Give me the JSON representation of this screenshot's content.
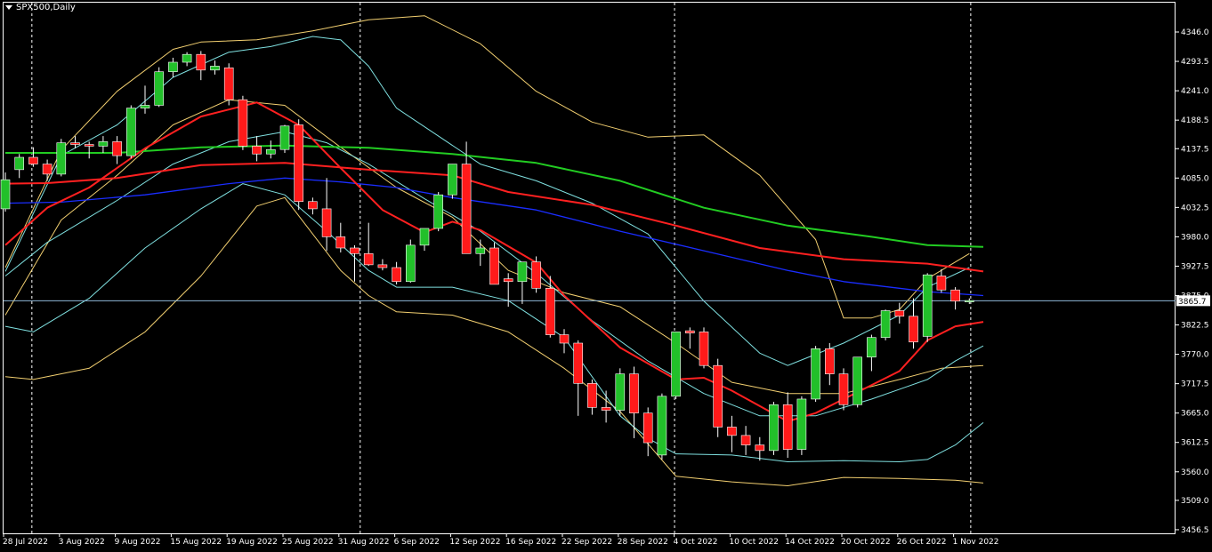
{
  "header": {
    "symbol_title": "SPX500,Daily"
  },
  "colors": {
    "bg": "#000000",
    "frame": "#ffffff",
    "up": "#22c02a",
    "down": "#ff1a1a",
    "ma_green": "#22cc22",
    "ma_red": "#ff2020",
    "ma_blue": "#1a2dff",
    "band_yellow": "#f2cf70",
    "band_cyan": "#7fe0e0",
    "bid_line": "#8fb8d8"
  },
  "chart_data": {
    "type": "candlestick",
    "ylim": [
      3430,
      4380
    ],
    "y_ticks": [
      "4346.0",
      "4293.5",
      "4241.0",
      "4188.5",
      "4137.5",
      "4085.0",
      "4032.5",
      "3980.0",
      "3927.5",
      "3875.0",
      "3822.5",
      "3770.0",
      "3717.5",
      "3665.0",
      "3612.5",
      "3560.0",
      "3509.0",
      "3456.5"
    ],
    "current_price": "3865.7",
    "x_labels": [
      {
        "i": 0,
        "label": "28 Jul 2022"
      },
      {
        "i": 4,
        "label": "3 Aug 2022"
      },
      {
        "i": 8,
        "label": "9 Aug 2022"
      },
      {
        "i": 12,
        "label": "15 Aug 2022"
      },
      {
        "i": 16,
        "label": "19 Aug 2022"
      },
      {
        "i": 20,
        "label": "25 Aug 2022"
      },
      {
        "i": 24,
        "label": "31 Aug 2022"
      },
      {
        "i": 28,
        "label": "6 Sep 2022"
      },
      {
        "i": 32,
        "label": "12 Sep 2022"
      },
      {
        "i": 36,
        "label": "16 Sep 2022"
      },
      {
        "i": 40,
        "label": "22 Sep 2022"
      },
      {
        "i": 44,
        "label": "28 Sep 2022"
      },
      {
        "i": 48,
        "label": "4 Oct 2022"
      },
      {
        "i": 52,
        "label": "10 Oct 2022"
      },
      {
        "i": 56,
        "label": "14 Oct 2022"
      },
      {
        "i": 60,
        "label": "20 Oct 2022"
      },
      {
        "i": 64,
        "label": "26 Oct 2022"
      },
      {
        "i": 68,
        "label": "1 Nov 2022"
      }
    ],
    "period_separators_at": [
      1.9,
      25.4,
      47.9,
      69.1
    ],
    "candles": [
      [
        4030,
        4095,
        4025,
        4082
      ],
      [
        4100,
        4128,
        4085,
        4122
      ],
      [
        4122,
        4140,
        4105,
        4110
      ],
      [
        4110,
        4118,
        4080,
        4092
      ],
      [
        4092,
        4155,
        4088,
        4148
      ],
      [
        4148,
        4160,
        4138,
        4145
      ],
      [
        4145,
        4150,
        4120,
        4142
      ],
      [
        4142,
        4160,
        4130,
        4150
      ],
      [
        4150,
        4160,
        4110,
        4125
      ],
      [
        4125,
        4215,
        4120,
        4210
      ],
      [
        4210,
        4250,
        4200,
        4215
      ],
      [
        4215,
        4283,
        4212,
        4275
      ],
      [
        4275,
        4300,
        4265,
        4292
      ],
      [
        4292,
        4310,
        4285,
        4306
      ],
      [
        4306,
        4312,
        4260,
        4278
      ],
      [
        4278,
        4295,
        4270,
        4285
      ],
      [
        4282,
        4290,
        4215,
        4225
      ],
      [
        4225,
        4232,
        4135,
        4142
      ],
      [
        4142,
        4160,
        4115,
        4128
      ],
      [
        4128,
        4152,
        4120,
        4136
      ],
      [
        4136,
        4180,
        4130,
        4178
      ],
      [
        4180,
        4190,
        4028,
        4043
      ],
      [
        4043,
        4050,
        4020,
        4030
      ],
      [
        4030,
        4085,
        3955,
        3980
      ],
      [
        3980,
        4005,
        3952,
        3960
      ],
      [
        3960,
        3965,
        3900,
        3950
      ],
      [
        3950,
        4005,
        3928,
        3930
      ],
      [
        3930,
        3940,
        3920,
        3925
      ],
      [
        3925,
        3935,
        3895,
        3900
      ],
      [
        3900,
        3975,
        3898,
        3965
      ],
      [
        3965,
        3990,
        3955,
        3995
      ],
      [
        3995,
        4060,
        3990,
        4055
      ],
      [
        4055,
        4110,
        4048,
        4110
      ],
      [
        4110,
        4150,
        3950,
        3950
      ],
      [
        3950,
        3975,
        3928,
        3960
      ],
      [
        3960,
        3970,
        3895,
        3895
      ],
      [
        3905,
        3915,
        3855,
        3900
      ],
      [
        3900,
        3920,
        3860,
        3935
      ],
      [
        3935,
        3945,
        3880,
        3888
      ],
      [
        3888,
        3910,
        3800,
        3805
      ],
      [
        3805,
        3815,
        3772,
        3790
      ],
      [
        3790,
        3795,
        3660,
        3718
      ],
      [
        3718,
        3725,
        3662,
        3675
      ],
      [
        3675,
        3705,
        3648,
        3670
      ],
      [
        3670,
        3745,
        3660,
        3735
      ],
      [
        3735,
        3748,
        3620,
        3665
      ],
      [
        3665,
        3675,
        3588,
        3612
      ],
      [
        3590,
        3700,
        3582,
        3695
      ],
      [
        3695,
        3810,
        3690,
        3810
      ],
      [
        3812,
        3818,
        3780,
        3808
      ],
      [
        3810,
        3818,
        3745,
        3750
      ],
      [
        3750,
        3762,
        3622,
        3640
      ],
      [
        3640,
        3660,
        3595,
        3625
      ],
      [
        3625,
        3642,
        3590,
        3608
      ],
      [
        3608,
        3622,
        3580,
        3598
      ],
      [
        3598,
        3685,
        3590,
        3680
      ],
      [
        3680,
        3702,
        3585,
        3600
      ],
      [
        3600,
        3695,
        3590,
        3690
      ],
      [
        3690,
        3785,
        3685,
        3780
      ],
      [
        3780,
        3790,
        3715,
        3735
      ],
      [
        3735,
        3745,
        3670,
        3680
      ],
      [
        3680,
        3765,
        3675,
        3765
      ],
      [
        3765,
        3805,
        3740,
        3800
      ],
      [
        3800,
        3850,
        3795,
        3848
      ],
      [
        3848,
        3862,
        3825,
        3838
      ],
      [
        3838,
        3870,
        3780,
        3792
      ],
      [
        3802,
        3915,
        3792,
        3912
      ],
      [
        3910,
        3922,
        3880,
        3885
      ],
      [
        3885,
        3890,
        3850,
        3865
      ],
      [
        3866,
        3870,
        3860,
        3866
      ]
    ],
    "ma_green": [
      [
        0,
        4130
      ],
      [
        3,
        4130
      ],
      [
        8,
        4130
      ],
      [
        14,
        4140
      ],
      [
        20,
        4143
      ],
      [
        26,
        4139
      ],
      [
        32,
        4128
      ],
      [
        38,
        4112
      ],
      [
        44,
        4080
      ],
      [
        50,
        4032
      ],
      [
        56,
        4000
      ],
      [
        62,
        3980
      ],
      [
        66,
        3965
      ],
      [
        70,
        3962
      ]
    ],
    "ma_red_slow": [
      [
        0,
        4075
      ],
      [
        3,
        4076
      ],
      [
        8,
        4085
      ],
      [
        14,
        4108
      ],
      [
        20,
        4112
      ],
      [
        26,
        4100
      ],
      [
        32,
        4090
      ],
      [
        36,
        4060
      ],
      [
        42,
        4037
      ],
      [
        48,
        4000
      ],
      [
        54,
        3960
      ],
      [
        60,
        3940
      ],
      [
        66,
        3932
      ],
      [
        70,
        3918
      ]
    ],
    "ma_blue": [
      [
        0,
        4040
      ],
      [
        4,
        4042
      ],
      [
        10,
        4055
      ],
      [
        16,
        4075
      ],
      [
        20,
        4085
      ],
      [
        24,
        4078
      ],
      [
        28,
        4068
      ],
      [
        32,
        4050
      ],
      [
        38,
        4028
      ],
      [
        44,
        3990
      ],
      [
        50,
        3955
      ],
      [
        56,
        3920
      ],
      [
        60,
        3900
      ],
      [
        66,
        3882
      ],
      [
        70,
        3875
      ]
    ],
    "ma_red_fast": [
      [
        0,
        3965
      ],
      [
        3,
        4032
      ],
      [
        6,
        4068
      ],
      [
        10,
        4138
      ],
      [
        14,
        4195
      ],
      [
        18,
        4220
      ],
      [
        21,
        4180
      ],
      [
        24,
        4103
      ],
      [
        27,
        4028
      ],
      [
        30,
        3988
      ],
      [
        32,
        4007
      ],
      [
        34,
        3992
      ],
      [
        38,
        3934
      ],
      [
        40,
        3875
      ],
      [
        44,
        3782
      ],
      [
        48,
        3725
      ],
      [
        50,
        3728
      ],
      [
        52,
        3705
      ],
      [
        56,
        3650
      ],
      [
        58,
        3665
      ],
      [
        60,
        3690
      ],
      [
        64,
        3740
      ],
      [
        66,
        3795
      ],
      [
        68,
        3820
      ],
      [
        70,
        3828
      ]
    ],
    "band_cyan_inner": [
      [
        0,
        3910
      ],
      [
        3,
        3970
      ],
      [
        8,
        4045
      ],
      [
        12,
        4110
      ],
      [
        16,
        4150
      ],
      [
        20,
        4168
      ],
      [
        23,
        4148
      ],
      [
        26,
        4110
      ],
      [
        30,
        4048
      ],
      [
        34,
        3990
      ],
      [
        38,
        3915
      ],
      [
        42,
        3830
      ],
      [
        46,
        3758
      ],
      [
        50,
        3700
      ],
      [
        54,
        3660
      ],
      [
        58,
        3660
      ],
      [
        62,
        3690
      ],
      [
        66,
        3725
      ],
      [
        68,
        3758
      ],
      [
        70,
        3785
      ]
    ],
    "band_cyan_upper": [
      [
        0,
        3918
      ],
      [
        4,
        4125
      ],
      [
        8,
        4180
      ],
      [
        12,
        4265
      ],
      [
        16,
        4310
      ],
      [
        19,
        4320
      ],
      [
        22,
        4338
      ],
      [
        24,
        4332
      ],
      [
        26,
        4285
      ],
      [
        28,
        4210
      ],
      [
        31,
        4160
      ],
      [
        34,
        4110
      ],
      [
        38,
        4080
      ],
      [
        42,
        4040
      ],
      [
        46,
        3985
      ],
      [
        50,
        3865
      ],
      [
        54,
        3772
      ],
      [
        56,
        3750
      ],
      [
        60,
        3790
      ],
      [
        64,
        3840
      ],
      [
        66,
        3890
      ],
      [
        69,
        3925
      ]
    ],
    "band_cyan_lower": [
      [
        0,
        3820
      ],
      [
        2,
        3810
      ],
      [
        6,
        3870
      ],
      [
        10,
        3960
      ],
      [
        14,
        4030
      ],
      [
        17,
        4075
      ],
      [
        20,
        4055
      ],
      [
        23,
        3990
      ],
      [
        26,
        3920
      ],
      [
        28,
        3890
      ],
      [
        32,
        3890
      ],
      [
        36,
        3866
      ],
      [
        40,
        3800
      ],
      [
        44,
        3660
      ],
      [
        46,
        3620
      ],
      [
        48,
        3592
      ],
      [
        52,
        3590
      ],
      [
        56,
        3578
      ],
      [
        60,
        3580
      ],
      [
        64,
        3578
      ],
      [
        66,
        3582
      ],
      [
        68,
        3608
      ],
      [
        70,
        3648
      ]
    ],
    "band_yellow_upper": [
      [
        0,
        3925
      ],
      [
        4,
        4135
      ],
      [
        8,
        4240
      ],
      [
        12,
        4315
      ],
      [
        14,
        4328
      ],
      [
        18,
        4332
      ],
      [
        22,
        4348
      ],
      [
        26,
        4368
      ],
      [
        30,
        4375
      ],
      [
        34,
        4325
      ],
      [
        38,
        4240
      ],
      [
        42,
        4185
      ],
      [
        46,
        4158
      ],
      [
        50,
        4162
      ],
      [
        54,
        4090
      ],
      [
        58,
        3975
      ],
      [
        60,
        3835
      ],
      [
        62,
        3835
      ],
      [
        64,
        3850
      ],
      [
        66,
        3905
      ],
      [
        69,
        3950
      ]
    ],
    "band_yellow_lower": [
      [
        0,
        3730
      ],
      [
        2,
        3725
      ],
      [
        6,
        3745
      ],
      [
        10,
        3810
      ],
      [
        14,
        3910
      ],
      [
        18,
        4035
      ],
      [
        20,
        4050
      ],
      [
        24,
        3920
      ],
      [
        26,
        3875
      ],
      [
        28,
        3846
      ],
      [
        32,
        3840
      ],
      [
        36,
        3810
      ],
      [
        40,
        3745
      ],
      [
        44,
        3668
      ],
      [
        48,
        3552
      ],
      [
        52,
        3542
      ],
      [
        56,
        3535
      ],
      [
        60,
        3550
      ],
      [
        64,
        3548
      ],
      [
        68,
        3545
      ],
      [
        70,
        3540
      ]
    ],
    "band_yellow_mid": [
      [
        0,
        3840
      ],
      [
        4,
        4010
      ],
      [
        8,
        4090
      ],
      [
        12,
        4180
      ],
      [
        16,
        4225
      ],
      [
        20,
        4215
      ],
      [
        24,
        4140
      ],
      [
        28,
        4068
      ],
      [
        32,
        4015
      ],
      [
        36,
        3920
      ],
      [
        40,
        3880
      ],
      [
        44,
        3855
      ],
      [
        48,
        3790
      ],
      [
        52,
        3720
      ],
      [
        56,
        3700
      ],
      [
        60,
        3700
      ],
      [
        64,
        3725
      ],
      [
        67,
        3745
      ],
      [
        70,
        3750
      ]
    ]
  }
}
